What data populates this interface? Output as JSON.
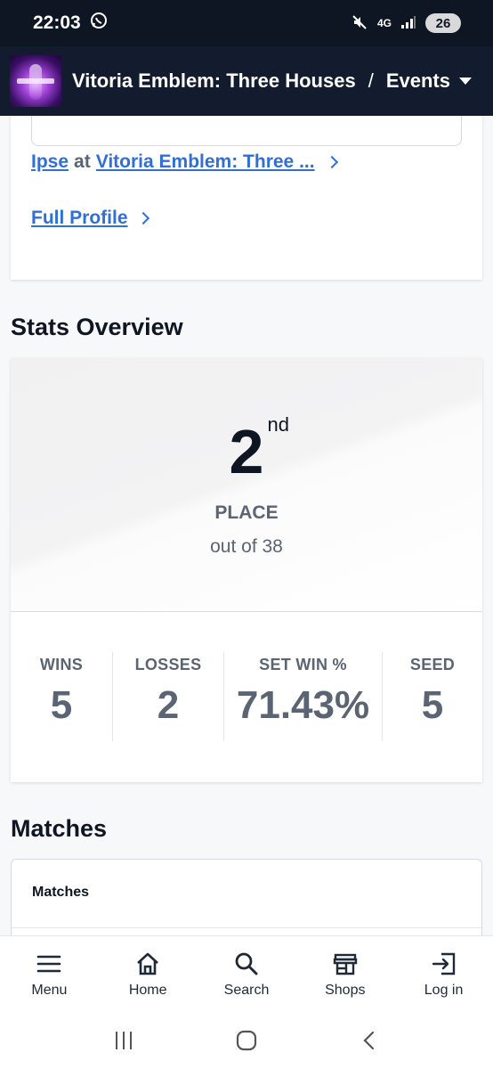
{
  "status_bar": {
    "time": "22:03",
    "network": "4G",
    "battery": "26"
  },
  "header": {
    "title": "Vitoria Emblem: Three Houses",
    "separator": "/",
    "section": "Events"
  },
  "profile": {
    "player_link": "Ipse",
    "at_text": "at",
    "event_link": "Vitoria Emblem: Three ...",
    "full_profile_label": "Full Profile"
  },
  "stats": {
    "heading": "Stats Overview",
    "place_number": "2",
    "place_suffix": "nd",
    "place_label": "PLACE",
    "out_of": "out of 38",
    "items": [
      {
        "label": "WINS",
        "value": "5"
      },
      {
        "label": "LOSSES",
        "value": "2"
      },
      {
        "label": "SET WIN %",
        "value": "71.43%"
      },
      {
        "label": "SEED",
        "value": "5"
      }
    ]
  },
  "matches": {
    "heading": "Matches",
    "card_title": "Matches"
  },
  "bottom_nav": [
    {
      "label": "Menu",
      "icon": "menu-icon"
    },
    {
      "label": "Home",
      "icon": "home-icon"
    },
    {
      "label": "Search",
      "icon": "search-icon"
    },
    {
      "label": "Shops",
      "icon": "shop-icon"
    },
    {
      "label": "Log in",
      "icon": "login-icon"
    }
  ],
  "colors": {
    "header_bg": "#131c2e",
    "link": "#2f6fd6",
    "muted_text": "#5b6473",
    "dark_text": "#0f1623"
  }
}
